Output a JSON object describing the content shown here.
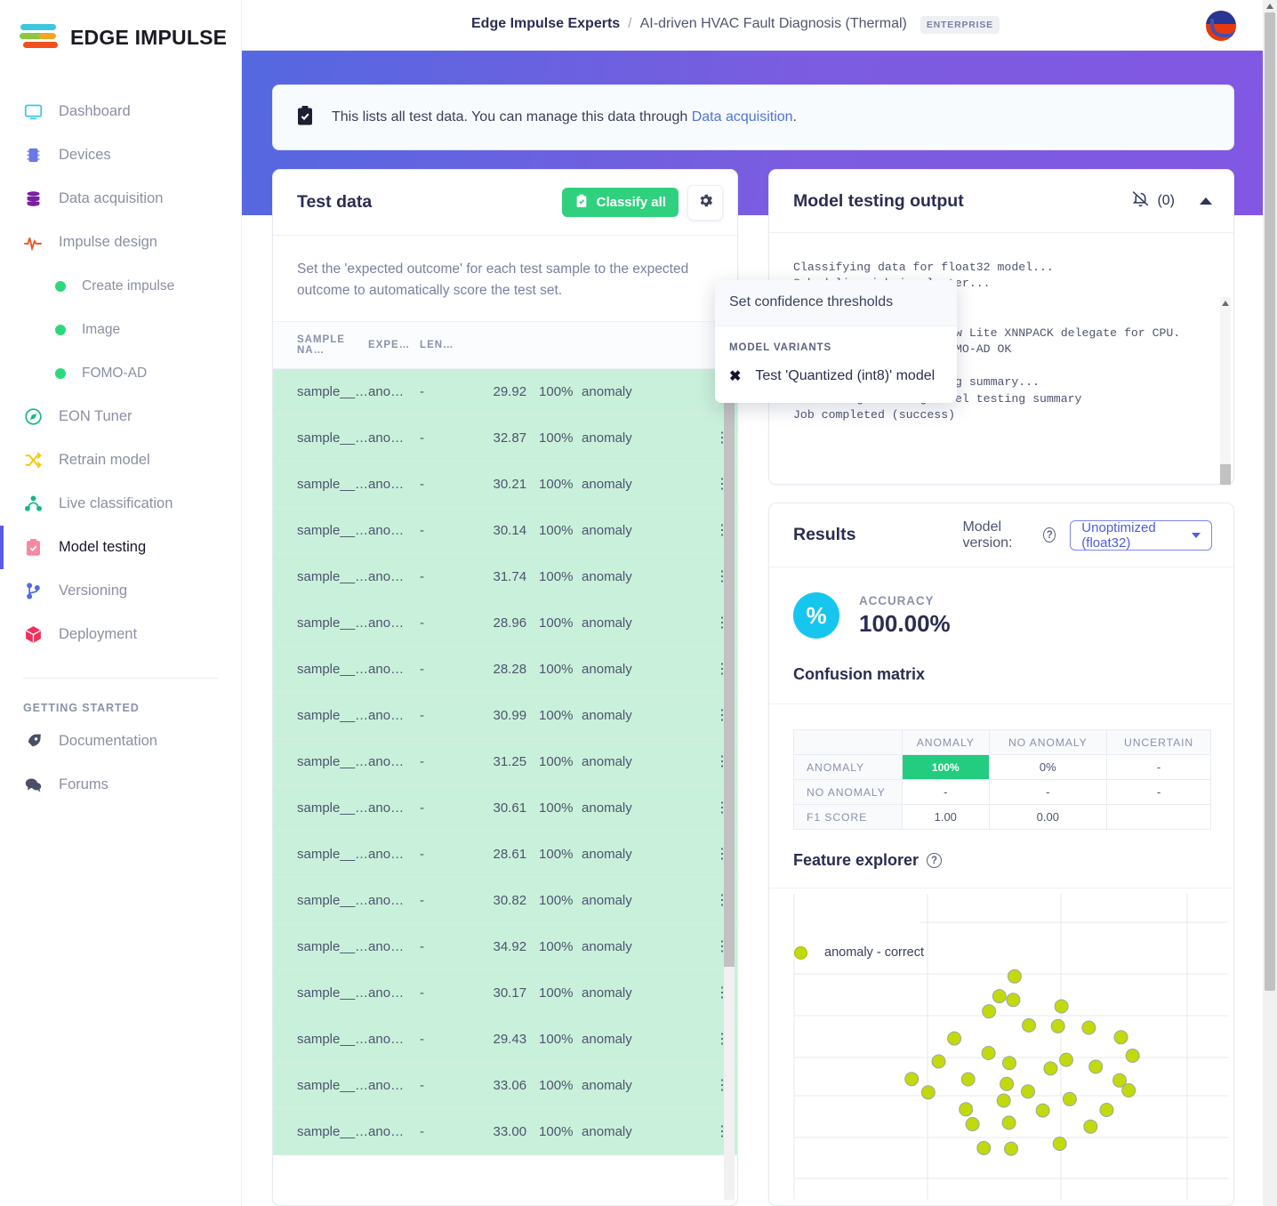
{
  "brand": {
    "name": "EDGE IMPULSE"
  },
  "topbar": {
    "org": "Edge Impulse Experts",
    "separator": "/",
    "project": "AI-driven HVAC Fault Diagnosis (Thermal)",
    "plan_badge": "ENTERPRISE",
    "avatar_name": "user-avatar"
  },
  "sidebar": {
    "items": [
      {
        "label": "Dashboard",
        "icon": "monitor-icon"
      },
      {
        "label": "Devices",
        "icon": "chip-icon"
      },
      {
        "label": "Data acquisition",
        "icon": "database-icon"
      },
      {
        "label": "Impulse design",
        "icon": "pulse-icon"
      }
    ],
    "subitems": [
      {
        "label": "Create impulse",
        "icon": "dot-icon"
      },
      {
        "label": "Image",
        "icon": "dot-icon"
      },
      {
        "label": "FOMO-AD",
        "icon": "dot-icon"
      }
    ],
    "items2": [
      {
        "label": "EON Tuner",
        "icon": "compass-icon"
      },
      {
        "label": "Retrain model",
        "icon": "shuffle-icon"
      },
      {
        "label": "Live classification",
        "icon": "network-icon"
      },
      {
        "label": "Model testing",
        "icon": "clipboard-check-icon",
        "active": true
      },
      {
        "label": "Versioning",
        "icon": "branch-icon"
      },
      {
        "label": "Deployment",
        "icon": "box-icon"
      }
    ],
    "section_label": "GETTING STARTED",
    "items3": [
      {
        "label": "Documentation",
        "icon": "rocket-icon"
      },
      {
        "label": "Forums",
        "icon": "chat-icon"
      }
    ]
  },
  "alert": {
    "icon": "clipboard-check-icon",
    "text_before": "This lists all test data. You can manage this data through ",
    "link_text": "Data acquisition",
    "text_after": "."
  },
  "test_data": {
    "title": "Test data",
    "classify_button": "Classify all",
    "classify_icon": "clipboard-check-icon",
    "gear_icon": "gear-icon",
    "hint": "Set the 'expected outcome' for each test sample to the expected outcome to automatically score the test set.",
    "columns": [
      "SAMPLE NA…",
      "EXPE…",
      "LEN…",
      "",
      "",
      "",
      ""
    ],
    "rows": [
      {
        "name": "sample__…",
        "expected": "ano…",
        "length": "-",
        "value": "29.92",
        "accuracy": "100%",
        "result": "anomaly"
      },
      {
        "name": "sample__…",
        "expected": "ano…",
        "length": "-",
        "value": "32.87",
        "accuracy": "100%",
        "result": "anomaly"
      },
      {
        "name": "sample__…",
        "expected": "ano…",
        "length": "-",
        "value": "30.21",
        "accuracy": "100%",
        "result": "anomaly"
      },
      {
        "name": "sample__…",
        "expected": "ano…",
        "length": "-",
        "value": "30.14",
        "accuracy": "100%",
        "result": "anomaly"
      },
      {
        "name": "sample__…",
        "expected": "ano…",
        "length": "-",
        "value": "31.74",
        "accuracy": "100%",
        "result": "anomaly"
      },
      {
        "name": "sample__…",
        "expected": "ano…",
        "length": "-",
        "value": "28.96",
        "accuracy": "100%",
        "result": "anomaly"
      },
      {
        "name": "sample__…",
        "expected": "ano…",
        "length": "-",
        "value": "28.28",
        "accuracy": "100%",
        "result": "anomaly"
      },
      {
        "name": "sample__…",
        "expected": "ano…",
        "length": "-",
        "value": "30.99",
        "accuracy": "100%",
        "result": "anomaly"
      },
      {
        "name": "sample__…",
        "expected": "ano…",
        "length": "-",
        "value": "31.25",
        "accuracy": "100%",
        "result": "anomaly"
      },
      {
        "name": "sample__…",
        "expected": "ano…",
        "length": "-",
        "value": "30.61",
        "accuracy": "100%",
        "result": "anomaly"
      },
      {
        "name": "sample__…",
        "expected": "ano…",
        "length": "-",
        "value": "28.61",
        "accuracy": "100%",
        "result": "anomaly"
      },
      {
        "name": "sample__…",
        "expected": "ano…",
        "length": "-",
        "value": "30.82",
        "accuracy": "100%",
        "result": "anomaly"
      },
      {
        "name": "sample__…",
        "expected": "ano…",
        "length": "-",
        "value": "34.92",
        "accuracy": "100%",
        "result": "anomaly"
      },
      {
        "name": "sample__…",
        "expected": "ano…",
        "length": "-",
        "value": "30.17",
        "accuracy": "100%",
        "result": "anomaly"
      },
      {
        "name": "sample__…",
        "expected": "ano…",
        "length": "-",
        "value": "29.43",
        "accuracy": "100%",
        "result": "anomaly"
      },
      {
        "name": "sample__…",
        "expected": "ano…",
        "length": "-",
        "value": "33.06",
        "accuracy": "100%",
        "result": "anomaly"
      },
      {
        "name": "sample__…",
        "expected": "ano…",
        "length": "-",
        "value": "33.00",
        "accuracy": "100%",
        "result": "anomaly"
      }
    ]
  },
  "dropdown": {
    "item_thresholds": "Set confidence thresholds",
    "section_label": "MODEL VARIANTS",
    "variant_icon": "x-icon",
    "variant_label": "Test 'Quantized (int8)' model"
  },
  "output": {
    "title": "Model testing output",
    "bell_icon": "bell-off-icon",
    "notification_count": "(0)",
    "collapse_icon": "chevron-up-icon",
    "log_lines": "Classifying data for float32 model...\nScheduling job in cluster...\nContainer image pulled!\nJob started\nINFO: Created TensorFlow Lite XNNPACK delegate for CPU.\nClassifying data for FOMO-AD OK\n\nGenerating model testing summary...\nFinished generating model testing summary\n",
    "success_line": "Job completed (success)"
  },
  "results": {
    "title": "Results",
    "model_version_label": "Model version:",
    "help_icon": "question-icon",
    "model_version_value": "Unoptimized (float32)",
    "accuracy_label": "ACCURACY",
    "accuracy_value": "100.00%",
    "accuracy_icon": "percent-icon",
    "confusion_title": "Confusion matrix",
    "feature_explorer_title": "Feature explorer",
    "feature_help_icon": "question-icon"
  },
  "chart_data": {
    "type": "table",
    "title": "Confusion matrix",
    "columns": [
      "",
      "ANOMALY",
      "NO ANOMALY",
      "UNCERTAIN"
    ],
    "rows": [
      {
        "header": "ANOMALY",
        "cells": [
          "100%",
          "0%",
          "-"
        ],
        "highlight": 0
      },
      {
        "header": "NO ANOMALY",
        "cells": [
          "-",
          "-",
          "-"
        ],
        "highlight": -1
      },
      {
        "header": "F1 SCORE",
        "cells": [
          "1.00",
          "0.00",
          ""
        ],
        "highlight": -1
      }
    ]
  },
  "feature_explorer": {
    "type": "scatter",
    "legend": [
      {
        "label": "anomaly - correct",
        "color": "#c2d90c"
      }
    ],
    "grid": true,
    "xlim": [
      0,
      100
    ],
    "ylim": [
      0,
      100
    ],
    "series": [
      {
        "name": "anomaly - correct",
        "color": "#c2d90c",
        "points": [
          [
            50.8,
            76.6
          ],
          [
            47.3,
            69.8
          ],
          [
            50.5,
            68.5
          ],
          [
            44.9,
            64.6
          ],
          [
            61.6,
            66.3
          ],
          [
            54.1,
            59.8
          ],
          [
            60.8,
            59.5
          ],
          [
            67.9,
            59.0
          ],
          [
            36.9,
            55.3
          ],
          [
            75.3,
            55.7
          ],
          [
            44.8,
            50.3
          ],
          [
            78.0,
            49.4
          ],
          [
            33.3,
            47.4
          ],
          [
            62.7,
            48.0
          ],
          [
            49.6,
            46.9
          ],
          [
            59.1,
            45.0
          ],
          [
            69.5,
            45.6
          ],
          [
            27.1,
            41.4
          ],
          [
            40.1,
            41.3
          ],
          [
            49.0,
            39.7
          ],
          [
            75.0,
            40.9
          ],
          [
            53.9,
            37.1
          ],
          [
            30.9,
            36.8
          ],
          [
            48.3,
            34.0
          ],
          [
            77.1,
            37.5
          ],
          [
            63.5,
            34.5
          ],
          [
            57.3,
            30.6
          ],
          [
            39.6,
            31.0
          ],
          [
            72.0,
            30.8
          ],
          [
            41.1,
            25.9
          ],
          [
            49.5,
            26.4
          ],
          [
            68.3,
            25.1
          ],
          [
            43.7,
            17.7
          ],
          [
            50.0,
            17.5
          ],
          [
            61.2,
            19.2
          ]
        ]
      }
    ]
  }
}
